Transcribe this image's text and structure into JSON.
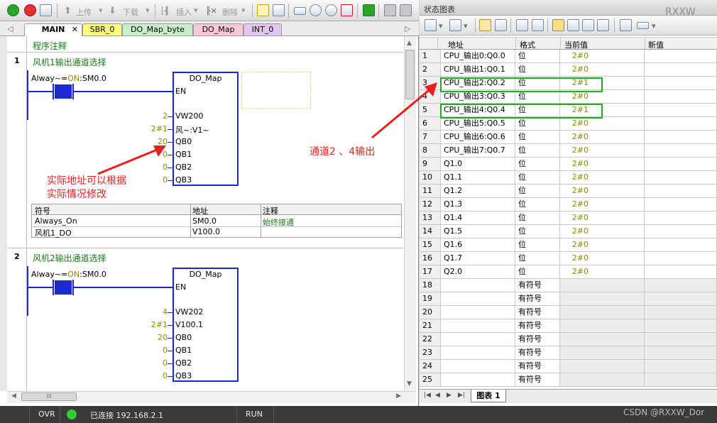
{
  "left_toolbar": {
    "upload_label": "上传",
    "download_label": "下载",
    "insert_label": "插入",
    "delete_label": "删除"
  },
  "tabs": [
    {
      "label": "MAIN",
      "color": "#ffffff"
    },
    {
      "label": "SBR_0",
      "color": "#ffff80"
    },
    {
      "label": "DO_Map_byte",
      "color": "#c8f0c8"
    },
    {
      "label": "DO_Map",
      "color": "#ffc8d8"
    },
    {
      "label": "INT_0",
      "color": "#e0c8f0"
    }
  ],
  "program_comment": "程序注释",
  "networks": [
    {
      "number": "1",
      "title": "风机1输出通道选择",
      "contact_label": "Alway~=ON:SM0.0",
      "contact_prefix": "Alway~=",
      "contact_on": "ON",
      "contact_suffix": ":SM0.0",
      "block_name": "DO_Map",
      "en": "EN",
      "pins": [
        {
          "value": "2",
          "name": "VW200"
        },
        {
          "value": "2#1",
          "name": "风~:V1~"
        },
        {
          "value": "20",
          "name": "QB0"
        },
        {
          "value": "0",
          "name": "QB1"
        },
        {
          "value": "0",
          "name": "QB2"
        },
        {
          "value": "0",
          "name": "QB3"
        }
      ],
      "symbol_table": {
        "headers": [
          "符号",
          "地址",
          "注释"
        ],
        "rows": [
          [
            "Always_On",
            "SM0.0",
            "始终接通"
          ],
          [
            "风机1_DO",
            "V100.0",
            ""
          ]
        ]
      }
    },
    {
      "number": "2",
      "title": "风机2输出通道选择",
      "contact_prefix": "Alway~=",
      "contact_on": "ON",
      "contact_suffix": ":SM0.0",
      "block_name": "DO_Map",
      "en": "EN",
      "pins": [
        {
          "value": "4",
          "name": "VW202"
        },
        {
          "value": "2#1",
          "name": "V100.1"
        },
        {
          "value": "20",
          "name": "QB0"
        },
        {
          "value": "0",
          "name": "QB1"
        },
        {
          "value": "0",
          "name": "QB2"
        },
        {
          "value": "0",
          "name": "QB3"
        }
      ]
    }
  ],
  "annotation_left": {
    "line1": "实际地址可以根据",
    "line2": "实际情况修改"
  },
  "annotation_right": "通道2 、4输出",
  "status_chart": {
    "title": "状态图表",
    "watermark": "RXXW",
    "headers": [
      "地址",
      "格式",
      "当前值",
      "新值"
    ],
    "rows": [
      {
        "n": "1",
        "addr": "CPU_输出0:Q0.0",
        "fmt": "位",
        "val": "2#0"
      },
      {
        "n": "2",
        "addr": "CPU_输出1:Q0.1",
        "fmt": "位",
        "val": "2#0"
      },
      {
        "n": "3",
        "addr": "CPU_输出2:Q0.2",
        "fmt": "位",
        "val": "2#1"
      },
      {
        "n": "4",
        "addr": "CPU_输出3:Q0.3",
        "fmt": "位",
        "val": "2#0"
      },
      {
        "n": "5",
        "addr": "CPU_输出4:Q0.4",
        "fmt": "位",
        "val": "2#1"
      },
      {
        "n": "6",
        "addr": "CPU_输出5:Q0.5",
        "fmt": "位",
        "val": "2#0"
      },
      {
        "n": "7",
        "addr": "CPU_输出6:Q0.6",
        "fmt": "位",
        "val": "2#0"
      },
      {
        "n": "8",
        "addr": "CPU_输出7:Q0.7",
        "fmt": "位",
        "val": "2#0"
      },
      {
        "n": "9",
        "addr": "Q1.0",
        "fmt": "位",
        "val": "2#0"
      },
      {
        "n": "10",
        "addr": "Q1.1",
        "fmt": "位",
        "val": "2#0"
      },
      {
        "n": "11",
        "addr": "Q1.2",
        "fmt": "位",
        "val": "2#0"
      },
      {
        "n": "12",
        "addr": "Q1.3",
        "fmt": "位",
        "val": "2#0"
      },
      {
        "n": "13",
        "addr": "Q1.4",
        "fmt": "位",
        "val": "2#0"
      },
      {
        "n": "14",
        "addr": "Q1.5",
        "fmt": "位",
        "val": "2#0"
      },
      {
        "n": "15",
        "addr": "Q1.6",
        "fmt": "位",
        "val": "2#0"
      },
      {
        "n": "16",
        "addr": "Q1.7",
        "fmt": "位",
        "val": "2#0"
      },
      {
        "n": "17",
        "addr": "Q2.0",
        "fmt": "位",
        "val": "2#0"
      },
      {
        "n": "18",
        "addr": "",
        "fmt": "有符号",
        "val": ""
      },
      {
        "n": "19",
        "addr": "",
        "fmt": "有符号",
        "val": ""
      },
      {
        "n": "20",
        "addr": "",
        "fmt": "有符号",
        "val": ""
      },
      {
        "n": "21",
        "addr": "",
        "fmt": "有符号",
        "val": ""
      },
      {
        "n": "22",
        "addr": "",
        "fmt": "有符号",
        "val": ""
      },
      {
        "n": "23",
        "addr": "",
        "fmt": "有符号",
        "val": ""
      },
      {
        "n": "24",
        "addr": "",
        "fmt": "有符号",
        "val": ""
      },
      {
        "n": "25",
        "addr": "",
        "fmt": "有符号",
        "val": ""
      }
    ],
    "sheet_tab": "图表 1"
  },
  "status_bar": {
    "mode": "OVR",
    "connection": "已连接 192.168.2.1",
    "run_state": "RUN",
    "watermark": "CSDN @RXXW_Dor"
  },
  "colors": {
    "accent_blue": "#1a2acf",
    "comment_green": "#1a7a1a",
    "value_olive": "#8a8a00",
    "annotation_red": "#e82020",
    "highlight_green": "#22aa22",
    "connected_green": "#33cc33"
  }
}
